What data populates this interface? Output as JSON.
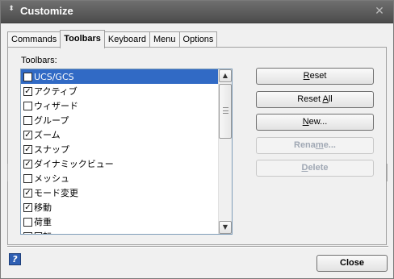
{
  "dialog": {
    "title": "Customize",
    "close_glyph": "✕",
    "grip_glyph": "⬍"
  },
  "tabs": [
    {
      "label": "Commands",
      "active": false
    },
    {
      "label": "Toolbars",
      "active": true
    },
    {
      "label": "Keyboard",
      "active": false
    },
    {
      "label": "Menu",
      "active": false
    },
    {
      "label": "Options",
      "active": false
    }
  ],
  "toolbars_label": "Toolbars:",
  "toolbar_list": [
    {
      "label": "UCS/GCS",
      "checked": false,
      "selected": true
    },
    {
      "label": "アクティブ",
      "checked": true,
      "selected": false
    },
    {
      "label": "ウィザード",
      "checked": false,
      "selected": false
    },
    {
      "label": "グループ",
      "checked": false,
      "selected": false
    },
    {
      "label": "ズーム",
      "checked": true,
      "selected": false
    },
    {
      "label": "スナップ",
      "checked": true,
      "selected": false
    },
    {
      "label": "ダイナミックビュー",
      "checked": true,
      "selected": false
    },
    {
      "label": "メッシュ",
      "checked": false,
      "selected": false
    },
    {
      "label": "モード変更",
      "checked": true,
      "selected": false
    },
    {
      "label": "移動",
      "checked": true,
      "selected": false
    },
    {
      "label": "荷重",
      "checked": false,
      "selected": false
    },
    {
      "label": "回転",
      "checked": false,
      "selected": false
    }
  ],
  "buttons": {
    "reset": {
      "label": "Reset",
      "underline": "R"
    },
    "reset_all": {
      "label": "Reset All",
      "underline": "A"
    },
    "new": {
      "label": "New...",
      "underline": "N"
    },
    "rename": {
      "label": "Rename...",
      "underline": "m",
      "disabled": true
    },
    "delete": {
      "label": "Delete",
      "underline": "D",
      "disabled": true
    }
  },
  "close_label": "Close",
  "help_icon": "help-icon",
  "help_glyph": "?"
}
